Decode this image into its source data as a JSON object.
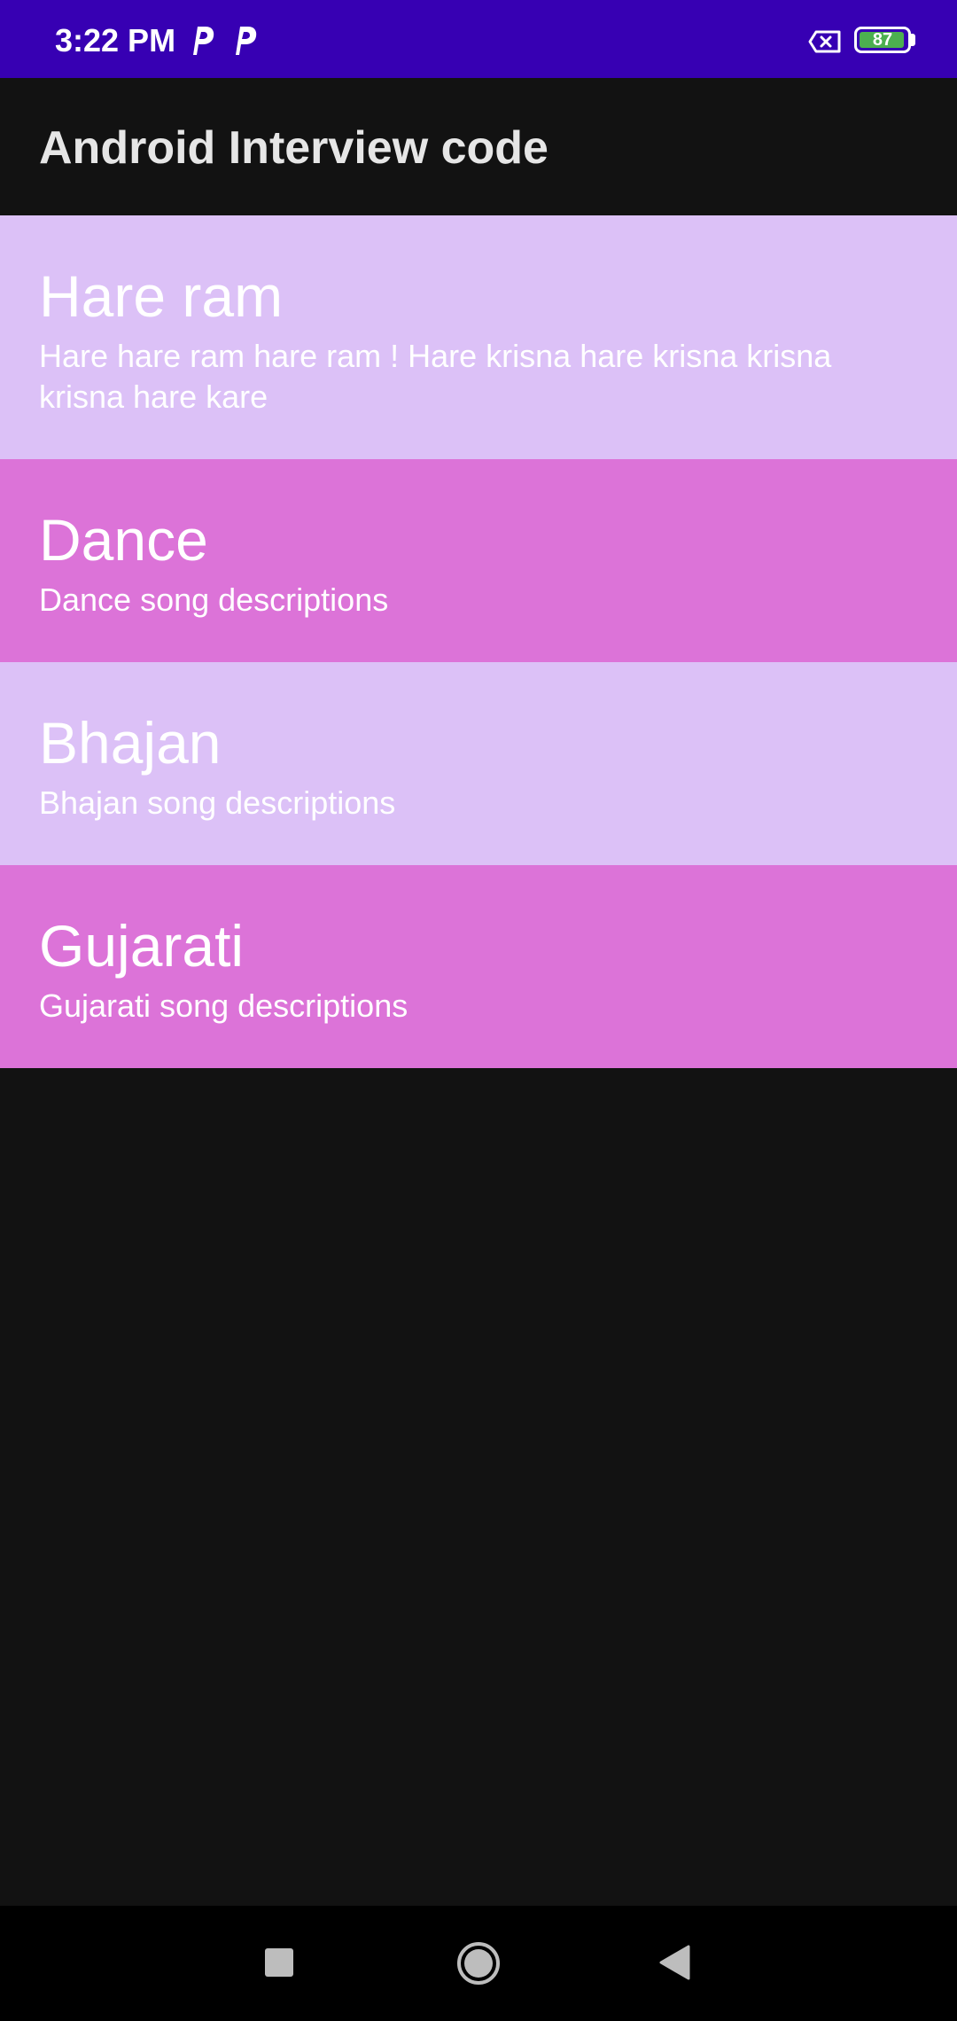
{
  "status_bar": {
    "time": "3:22 PM",
    "battery_level": "87",
    "colors": {
      "background": "#3700B3",
      "battery_fill": "#4caf50"
    },
    "icons": [
      "p-icon",
      "p-icon",
      "sim-disabled-icon",
      "battery-icon"
    ]
  },
  "app_bar": {
    "title": "Android Interview code"
  },
  "songs": [
    {
      "title": "Hare ram",
      "description": "Hare hare ram hare ram ! Hare krisna hare krisna krisna krisna hare kare"
    },
    {
      "title": "Dance",
      "description": "Dance song descriptions"
    },
    {
      "title": "Bhajan",
      "description": "Bhajan song descriptions"
    },
    {
      "title": "Gujarati",
      "description": "Gujarati song descriptions"
    }
  ],
  "colors": {
    "item_light": "#DCC1F7",
    "item_dark": "#DC73D8",
    "background": "#121212"
  },
  "nav_bar": {
    "icons": [
      "recents-icon",
      "home-icon",
      "back-icon"
    ]
  }
}
